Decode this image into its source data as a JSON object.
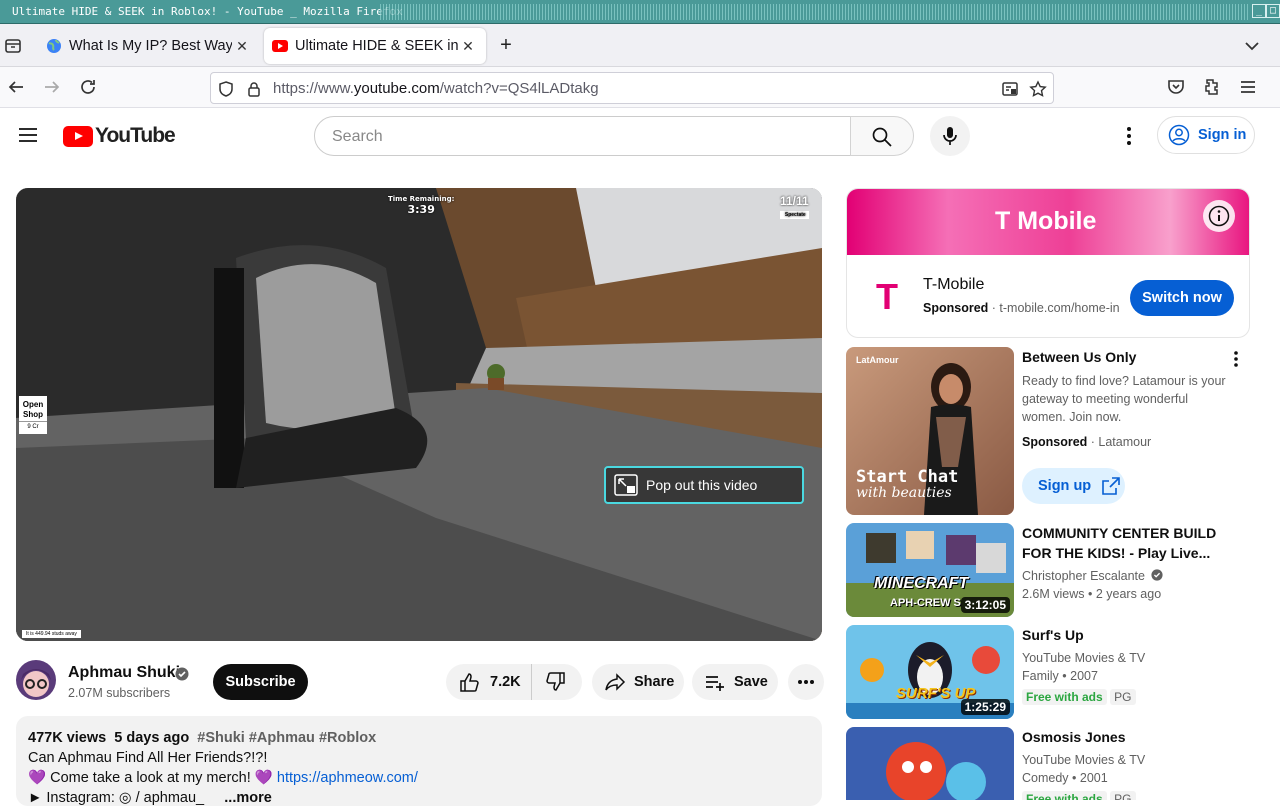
{
  "window": {
    "title": "Ultimate HIDE & SEEK in Roblox! - YouTube  _ Mozilla Firefox"
  },
  "tabs": [
    {
      "label": "What Is My IP? Best Way T",
      "favicon": "globe-icon",
      "active": false
    },
    {
      "label": "Ultimate HIDE & SEEK in R",
      "favicon": "youtube-icon",
      "active": true
    }
  ],
  "navbar": {
    "url_prefix": "https://www.",
    "url_domain": "youtube.com",
    "url_path": "/watch?v=QS4lLADtakg"
  },
  "header": {
    "logo_text": "YouTube",
    "search_placeholder": "Search",
    "signin_label": "Sign in"
  },
  "player": {
    "time_remaining_label": "Time Remaining:",
    "time_remaining": "3:39",
    "player_count": "11/11",
    "spectate_label": "Spectate",
    "shop_line1": "Open",
    "shop_line2": "Shop",
    "shop_cost": "9 Cr",
    "studs_text": "It is 449.94 studs away",
    "popout_label": "Pop out this video"
  },
  "channel": {
    "name": "Aphmau Shuki",
    "subscribers": "2.07M subscribers",
    "subscribe_label": "Subscribe"
  },
  "actions": {
    "likes": "7.2K",
    "share_label": "Share",
    "save_label": "Save"
  },
  "description": {
    "views": "477K views",
    "date": "5 days ago",
    "tags": "#Shuki #Aphmau #Roblox",
    "line1": "Can Aphmau Find All Her Friends?!?!",
    "line2_heart": "💜",
    "line2_text": " Come take a look at my merch! ",
    "line2_heart2": "💜",
    "line2_link": "https://aphmeow.com/",
    "line3": "► Instagram:  ◎ / aphmau_",
    "more": "...more"
  },
  "ad": {
    "banner_brand": "T Mobile",
    "logo": "T",
    "name": "T-Mobile",
    "sponsored": "Sponsored",
    "url": " · t-mobile.com/home-int",
    "cta": "Switch now"
  },
  "recommendations": [
    {
      "title": "Between Us Only",
      "desc": "Ready to find love? Latamour is your gateway to meeting wonderful women. Join now.",
      "sponsored": "Sponsored",
      "advertiser": " · Latamour",
      "cta": "Sign up",
      "thumb_brand": "LatAmour",
      "thumb_line1": "Start Chat",
      "thumb_line2": "with beauties"
    },
    {
      "title": "COMMUNITY CENTER BUILD FOR THE KIDS! - Play Live...",
      "channel": "Christopher Escalante",
      "meta": "2.6M views  • 2 years ago",
      "duration": "3:12:05",
      "thumb_text1": "MINECRAFT",
      "thumb_text2": "APH-CREW S"
    },
    {
      "title": "Surf's Up",
      "channel": "YouTube Movies & TV",
      "meta": "Family • 2007",
      "badge_free": "Free with ads",
      "badge_rating": "PG",
      "duration": "1:25:29",
      "thumb_text": "SURF'S UP"
    },
    {
      "title": "Osmosis Jones",
      "channel": "YouTube Movies & TV",
      "meta": "Comedy • 2001",
      "badge_free": "Free with ads",
      "badge_rating": "PG"
    }
  ],
  "colors": {
    "brand_red": "#ff0000",
    "link_blue": "#065fd4",
    "tmobile_magenta": "#e20074",
    "free_green": "#2ba640"
  }
}
